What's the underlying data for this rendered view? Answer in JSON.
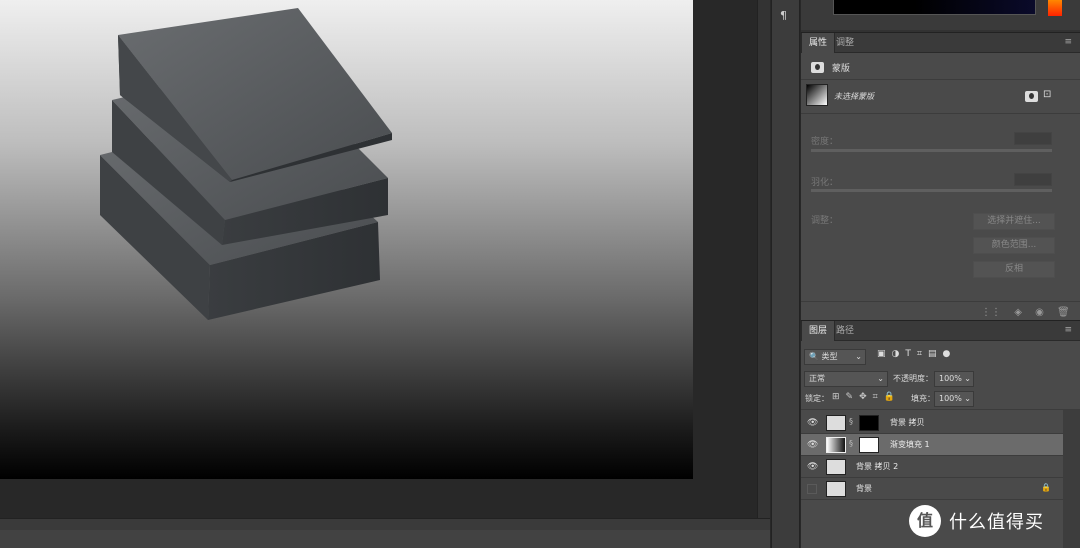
{
  "tool_strip": {
    "icons": [
      "paragraph-icon"
    ],
    "paragraph_glyph": "¶"
  },
  "properties_panel": {
    "tabs": [
      "属性",
      "调整"
    ],
    "section_label": "蒙版",
    "mask_state": "未选择蒙版",
    "density_label": "密度：",
    "feather_label": "羽化：",
    "adjust_label": "调整：",
    "buttons": {
      "select_and_mask": "选择并遮住...",
      "color_range": "颜色范围...",
      "invert": "反相"
    }
  },
  "layers_panel": {
    "tabs": [
      "图层",
      "路径"
    ],
    "filter_kind": "类型",
    "blend_mode": "正常",
    "opacity_label": "不透明度：",
    "opacity_value": "100%",
    "lock_label": "锁定：",
    "fill_label": "填充：",
    "fill_value": "100%",
    "layers": [
      {
        "name": "背景 拷贝",
        "visible": true,
        "selected": false,
        "has_mask": true
      },
      {
        "name": "渐变填充 1",
        "visible": true,
        "selected": true,
        "has_mask": true
      },
      {
        "name": "背景 拷贝 2",
        "visible": true,
        "selected": false,
        "has_mask": false
      },
      {
        "name": "背景",
        "visible": false,
        "selected": false,
        "has_mask": false,
        "locked": true
      }
    ]
  },
  "watermark": {
    "logo": "值",
    "text": "什么值得买"
  },
  "colors": {
    "accent_hue": "#ff5500",
    "panel_bg": "#4a4a4a",
    "selected_row": "#6b6b6b"
  }
}
